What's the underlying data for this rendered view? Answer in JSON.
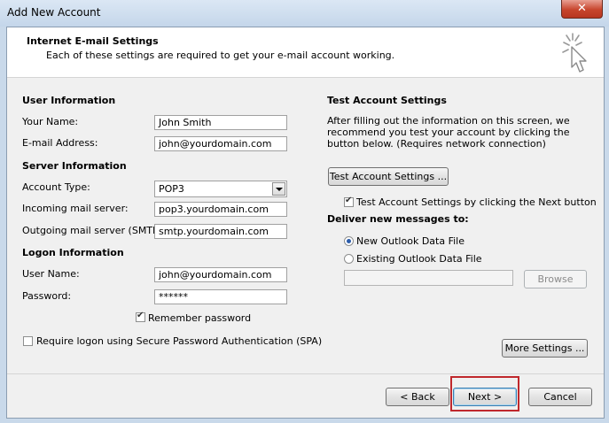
{
  "window": {
    "title": "Add New Account",
    "close_glyph": "✕"
  },
  "header": {
    "title": "Internet E-mail Settings",
    "subtitle": "Each of these settings are required to get your e-mail account working.",
    "icon": "cursor-click-icon"
  },
  "user_info": {
    "heading": "User Information",
    "name_label": "Your Name:",
    "name_value": "John Smith",
    "email_label": "E-mail Address:",
    "email_value": "john@yourdomain.com"
  },
  "server_info": {
    "heading": "Server Information",
    "account_type_label": "Account Type:",
    "account_type_value": "POP3",
    "incoming_label": "Incoming mail server:",
    "incoming_value": "pop3.yourdomain.com",
    "outgoing_label": "Outgoing mail server (SMTP):",
    "outgoing_value": "smtp.yourdomain.com"
  },
  "logon_info": {
    "heading": "Logon Information",
    "username_label": "User Name:",
    "username_value": "john@yourdomain.com",
    "password_label": "Password:",
    "password_value": "******",
    "remember_label": "Remember password",
    "remember_checked": true,
    "spa_label": "Require logon using Secure Password Authentication (SPA)",
    "spa_checked": false
  },
  "test_settings": {
    "heading": "Test Account Settings",
    "description": "After filling out the information on this screen, we recommend you test your account by clicking the button below. (Requires network connection)",
    "test_button": "Test Account Settings ...",
    "test_on_next_label": "Test Account Settings by clicking the Next button",
    "test_on_next_checked": true
  },
  "deliver": {
    "heading": "Deliver new messages to:",
    "option_new": "New Outlook Data File",
    "option_existing": "Existing Outlook Data File",
    "selected": "new",
    "path_value": "",
    "browse_button": "Browse"
  },
  "buttons": {
    "more_settings": "More Settings ...",
    "back": "< Back",
    "next": "Next >",
    "cancel": "Cancel"
  },
  "colors": {
    "highlight": "#c0282c",
    "accent": "#2b5caa"
  }
}
